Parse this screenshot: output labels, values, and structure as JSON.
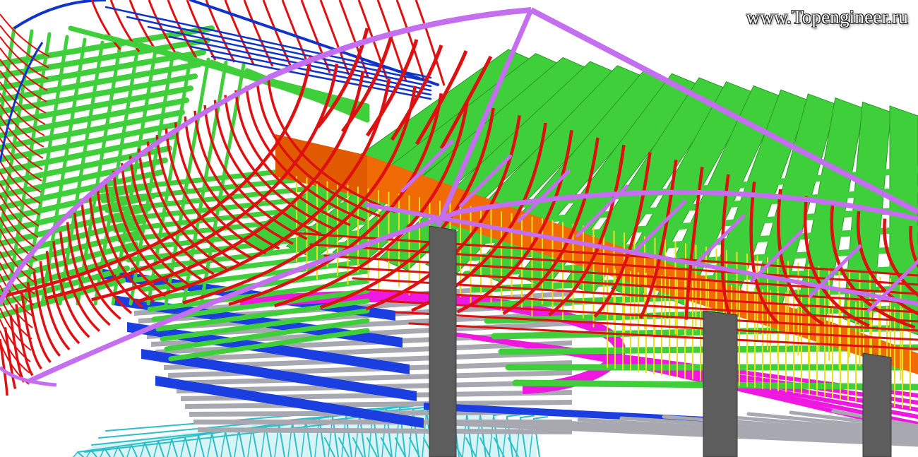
{
  "watermark": {
    "text": "www.Topengineer.ru"
  },
  "colors": {
    "rafter": "#dd1111",
    "edge_beam": "#c46ef0",
    "joist": "#3fcf3a",
    "joist_dark": "#2a9a26",
    "girder": "#f06a05",
    "column": "#5d5d5d",
    "hanger": "#e8e020",
    "deck_blue": "#1a3ee0",
    "deck_grey": "#a8a8b0",
    "deck_magenta": "#ee18e0",
    "truss": "#2bbfc8",
    "roof_blue": "#1034c8"
  },
  "icons": [
    "structural-3d-model"
  ]
}
